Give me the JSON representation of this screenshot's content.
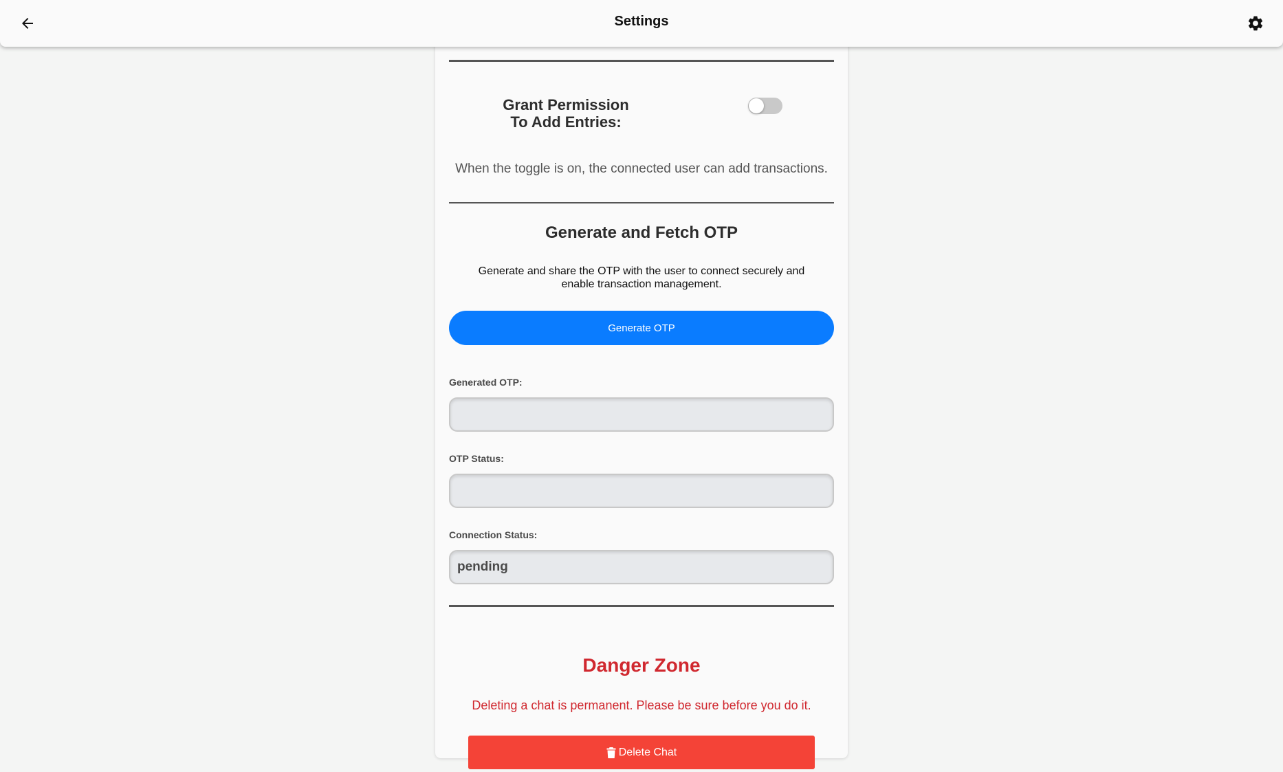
{
  "header": {
    "title": "Settings",
    "back_icon": "arrow-left-icon",
    "settings_icon": "gear-icon"
  },
  "permission": {
    "label_line1": "Grant Permission",
    "label_line2": "To Add Entries:",
    "toggle_on": false,
    "description": "When the toggle is on, the connected user can add transactions."
  },
  "otp": {
    "title": "Generate and Fetch OTP",
    "description": "Generate and share the OTP with the user to connect securely and enable transaction management.",
    "generate_label": "Generate OTP",
    "generated_label": "Generated OTP:",
    "generated_value": "",
    "status_label": "OTP Status:",
    "status_value": "",
    "connection_label": "Connection Status:",
    "connection_value": "pending",
    "button_color": "#0a7cff"
  },
  "danger": {
    "title": "Danger Zone",
    "description": "Deleting a chat is permanent. Please be sure before you do it.",
    "delete_label": "Delete Chat",
    "delete_icon": "trash-icon",
    "color": "#d0282f",
    "button_color": "#f44337"
  }
}
